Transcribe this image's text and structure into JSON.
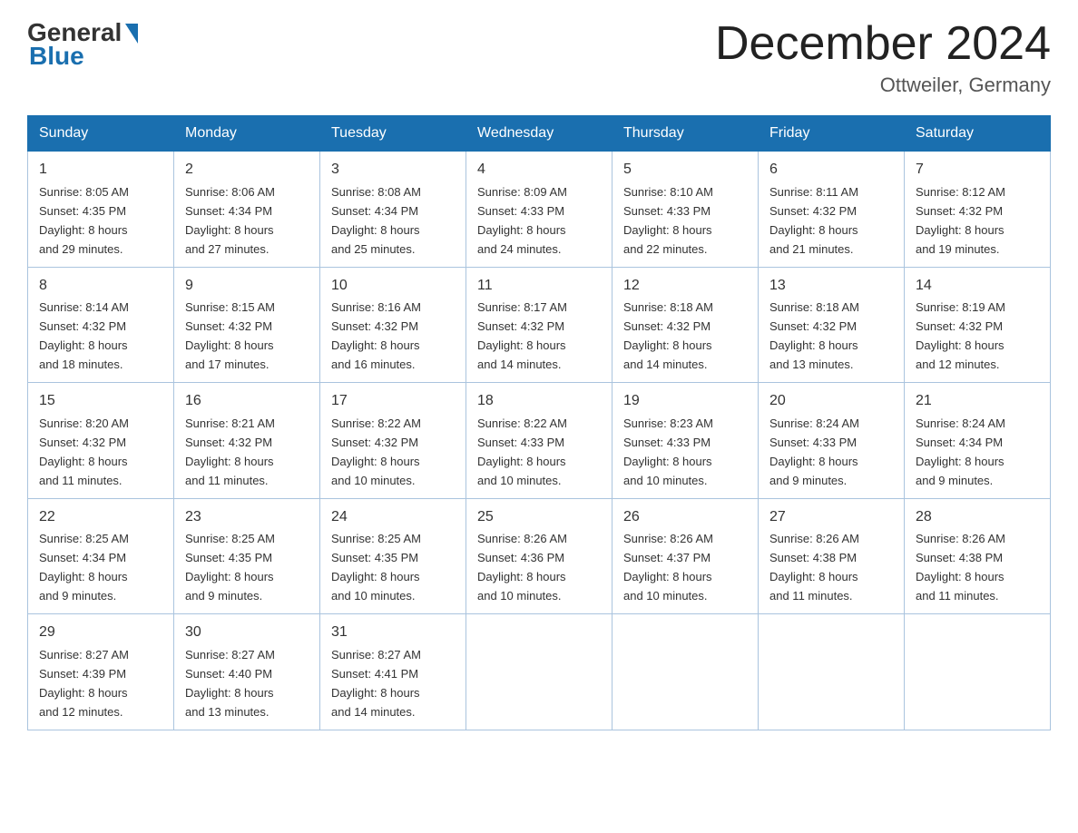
{
  "logo": {
    "general": "General",
    "blue": "Blue"
  },
  "title": "December 2024",
  "location": "Ottweiler, Germany",
  "weekdays": [
    "Sunday",
    "Monday",
    "Tuesday",
    "Wednesday",
    "Thursday",
    "Friday",
    "Saturday"
  ],
  "weeks": [
    [
      {
        "day": "1",
        "sunrise": "8:05 AM",
        "sunset": "4:35 PM",
        "daylight": "8 hours and 29 minutes."
      },
      {
        "day": "2",
        "sunrise": "8:06 AM",
        "sunset": "4:34 PM",
        "daylight": "8 hours and 27 minutes."
      },
      {
        "day": "3",
        "sunrise": "8:08 AM",
        "sunset": "4:34 PM",
        "daylight": "8 hours and 25 minutes."
      },
      {
        "day": "4",
        "sunrise": "8:09 AM",
        "sunset": "4:33 PM",
        "daylight": "8 hours and 24 minutes."
      },
      {
        "day": "5",
        "sunrise": "8:10 AM",
        "sunset": "4:33 PM",
        "daylight": "8 hours and 22 minutes."
      },
      {
        "day": "6",
        "sunrise": "8:11 AM",
        "sunset": "4:32 PM",
        "daylight": "8 hours and 21 minutes."
      },
      {
        "day": "7",
        "sunrise": "8:12 AM",
        "sunset": "4:32 PM",
        "daylight": "8 hours and 19 minutes."
      }
    ],
    [
      {
        "day": "8",
        "sunrise": "8:14 AM",
        "sunset": "4:32 PM",
        "daylight": "8 hours and 18 minutes."
      },
      {
        "day": "9",
        "sunrise": "8:15 AM",
        "sunset": "4:32 PM",
        "daylight": "8 hours and 17 minutes."
      },
      {
        "day": "10",
        "sunrise": "8:16 AM",
        "sunset": "4:32 PM",
        "daylight": "8 hours and 16 minutes."
      },
      {
        "day": "11",
        "sunrise": "8:17 AM",
        "sunset": "4:32 PM",
        "daylight": "8 hours and 14 minutes."
      },
      {
        "day": "12",
        "sunrise": "8:18 AM",
        "sunset": "4:32 PM",
        "daylight": "8 hours and 14 minutes."
      },
      {
        "day": "13",
        "sunrise": "8:18 AM",
        "sunset": "4:32 PM",
        "daylight": "8 hours and 13 minutes."
      },
      {
        "day": "14",
        "sunrise": "8:19 AM",
        "sunset": "4:32 PM",
        "daylight": "8 hours and 12 minutes."
      }
    ],
    [
      {
        "day": "15",
        "sunrise": "8:20 AM",
        "sunset": "4:32 PM",
        "daylight": "8 hours and 11 minutes."
      },
      {
        "day": "16",
        "sunrise": "8:21 AM",
        "sunset": "4:32 PM",
        "daylight": "8 hours and 11 minutes."
      },
      {
        "day": "17",
        "sunrise": "8:22 AM",
        "sunset": "4:32 PM",
        "daylight": "8 hours and 10 minutes."
      },
      {
        "day": "18",
        "sunrise": "8:22 AM",
        "sunset": "4:33 PM",
        "daylight": "8 hours and 10 minutes."
      },
      {
        "day": "19",
        "sunrise": "8:23 AM",
        "sunset": "4:33 PM",
        "daylight": "8 hours and 10 minutes."
      },
      {
        "day": "20",
        "sunrise": "8:24 AM",
        "sunset": "4:33 PM",
        "daylight": "8 hours and 9 minutes."
      },
      {
        "day": "21",
        "sunrise": "8:24 AM",
        "sunset": "4:34 PM",
        "daylight": "8 hours and 9 minutes."
      }
    ],
    [
      {
        "day": "22",
        "sunrise": "8:25 AM",
        "sunset": "4:34 PM",
        "daylight": "8 hours and 9 minutes."
      },
      {
        "day": "23",
        "sunrise": "8:25 AM",
        "sunset": "4:35 PM",
        "daylight": "8 hours and 9 minutes."
      },
      {
        "day": "24",
        "sunrise": "8:25 AM",
        "sunset": "4:35 PM",
        "daylight": "8 hours and 10 minutes."
      },
      {
        "day": "25",
        "sunrise": "8:26 AM",
        "sunset": "4:36 PM",
        "daylight": "8 hours and 10 minutes."
      },
      {
        "day": "26",
        "sunrise": "8:26 AM",
        "sunset": "4:37 PM",
        "daylight": "8 hours and 10 minutes."
      },
      {
        "day": "27",
        "sunrise": "8:26 AM",
        "sunset": "4:38 PM",
        "daylight": "8 hours and 11 minutes."
      },
      {
        "day": "28",
        "sunrise": "8:26 AM",
        "sunset": "4:38 PM",
        "daylight": "8 hours and 11 minutes."
      }
    ],
    [
      {
        "day": "29",
        "sunrise": "8:27 AM",
        "sunset": "4:39 PM",
        "daylight": "8 hours and 12 minutes."
      },
      {
        "day": "30",
        "sunrise": "8:27 AM",
        "sunset": "4:40 PM",
        "daylight": "8 hours and 13 minutes."
      },
      {
        "day": "31",
        "sunrise": "8:27 AM",
        "sunset": "4:41 PM",
        "daylight": "8 hours and 14 minutes."
      },
      null,
      null,
      null,
      null
    ]
  ],
  "labels": {
    "sunrise": "Sunrise:",
    "sunset": "Sunset:",
    "daylight": "Daylight:"
  }
}
